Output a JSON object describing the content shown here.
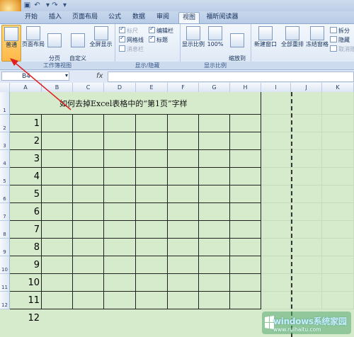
{
  "tabs": [
    "开始",
    "插入",
    "页面布局",
    "公式",
    "数据",
    "审阅",
    "视图",
    "福昕阅读器"
  ],
  "active_tab": "视图",
  "ribbon": {
    "workbook_views": {
      "label": "工作簿视图",
      "buttons": [
        "普通",
        "页面布局",
        "分页\n预览",
        "自定义\n视图",
        "全屏显示"
      ]
    },
    "show_hide": {
      "label": "显示/隐藏",
      "checks": [
        {
          "text": "标尺",
          "checked": true,
          "dim": true
        },
        {
          "text": "编辑栏",
          "checked": true,
          "dim": false
        },
        {
          "text": "网格线",
          "checked": true,
          "dim": false
        },
        {
          "text": "标题",
          "checked": true,
          "dim": false
        },
        {
          "text": "消息栏",
          "checked": false,
          "dim": true
        }
      ]
    },
    "zoom": {
      "label": "显示比例",
      "buttons": [
        "显示比例",
        "100%",
        "缩放到\n选定区域"
      ]
    },
    "window": {
      "buttons": [
        "新建窗口",
        "全部重排",
        "冻结窗格"
      ],
      "small": [
        "拆分",
        "隐藏",
        "取消隐"
      ]
    }
  },
  "formula_bar": {
    "name_box": "B4",
    "fx": "fx"
  },
  "columns": [
    "A",
    "B",
    "C",
    "D",
    "E",
    "F",
    "G",
    "H",
    "I",
    "J",
    "K"
  ],
  "rows": [
    "1",
    "2",
    "3",
    "4",
    "5",
    "6",
    "7",
    "8",
    "9",
    "10",
    "11",
    "12"
  ],
  "cell_title": "如何去掉Excel表格中的“第1页”字样",
  "col_a_values": [
    "1",
    "2",
    "3",
    "4",
    "5",
    "6",
    "7",
    "8",
    "9",
    "10",
    "11",
    "12"
  ],
  "watermark": {
    "line1a": "windows",
    "line1b": "系统家园",
    "line2": "www.ruihaitu.com"
  }
}
